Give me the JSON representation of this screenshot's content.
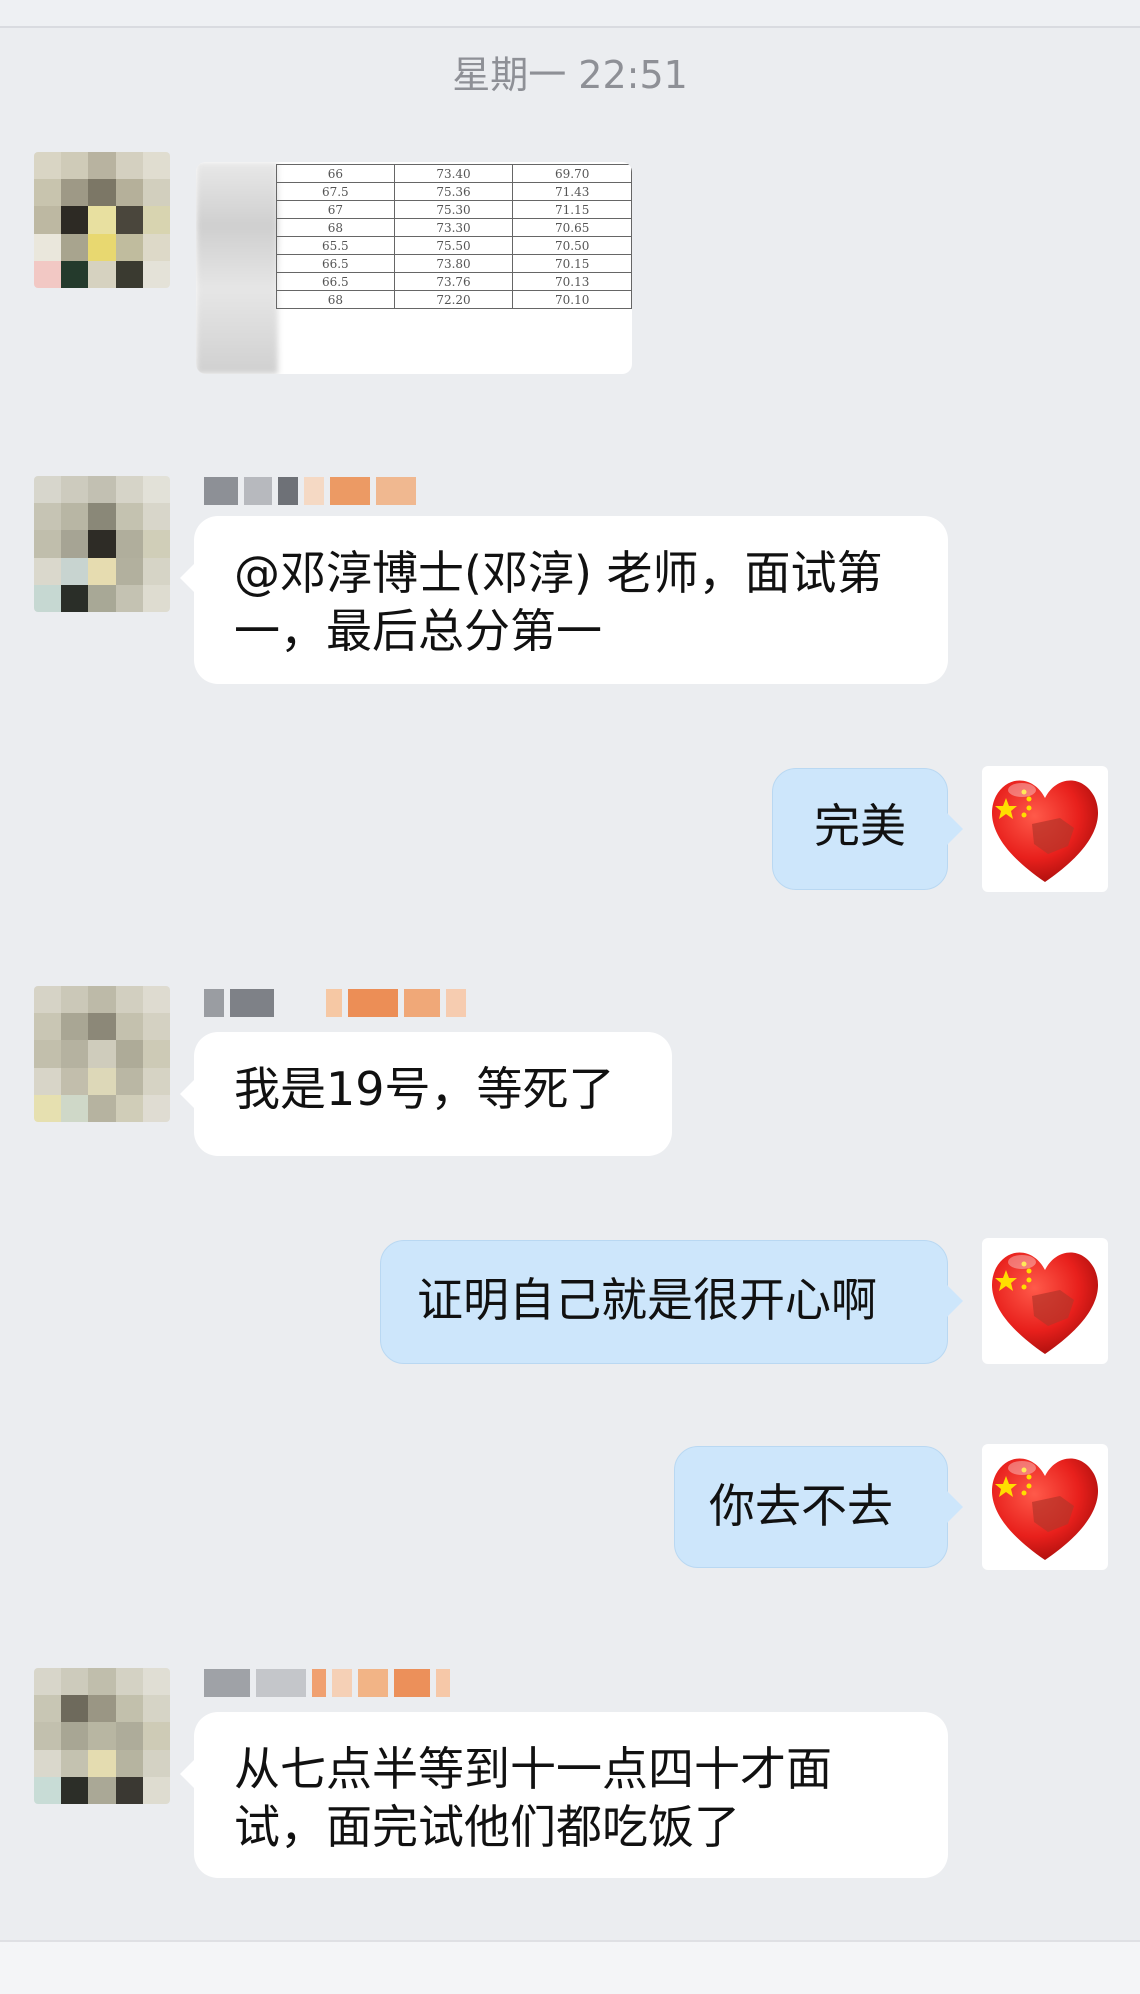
{
  "topbar": {
    "title": ""
  },
  "timestamp": "星期一  22:51",
  "messages": [
    {
      "type": "image",
      "side": "left",
      "table_rows": [
        [
          "66",
          "73.40",
          "69.70"
        ],
        [
          "67.5",
          "75.36",
          "71.43"
        ],
        [
          "67",
          "75.30",
          "71.15"
        ],
        [
          "68",
          "73.30",
          "70.65"
        ],
        [
          "65.5",
          "75.50",
          "70.50"
        ],
        [
          "66.5",
          "73.80",
          "70.15"
        ],
        [
          "66.5",
          "73.76",
          "70.13"
        ],
        [
          "68",
          "72.20",
          "70.10"
        ]
      ]
    },
    {
      "type": "text",
      "side": "left",
      "text": "@邓淳博士(邓淳) 老师，面试第一，最后总分第一"
    },
    {
      "type": "text",
      "side": "right",
      "text": "完美"
    },
    {
      "type": "text",
      "side": "left",
      "text": "我是19号，等死了"
    },
    {
      "type": "text",
      "side": "right",
      "text": "证明自己就是很开心啊"
    },
    {
      "type": "text",
      "side": "right",
      "text": "你去不去"
    },
    {
      "type": "text",
      "side": "left",
      "text": "从七点半等到十一点四十才面试，面完试他们都吃饭了"
    }
  ],
  "icons": {
    "self_avatar": "heart-with-china-flag-icon",
    "contact_avatar": "pixelated-avatar"
  },
  "colors": {
    "background": "#ebedf0",
    "left_bubble": "#ffffff",
    "right_bubble": "#cde6fb",
    "heart_red": "#e8201c",
    "star_yellow": "#ffde00"
  }
}
